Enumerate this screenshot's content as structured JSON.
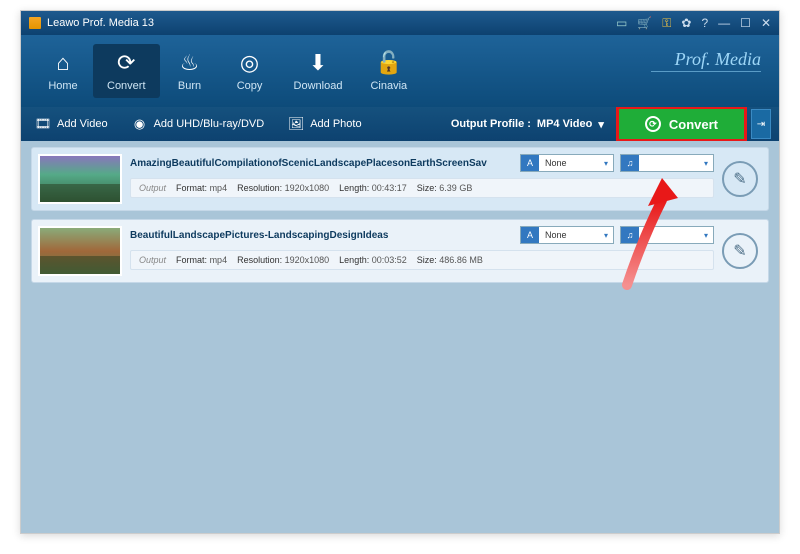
{
  "titlebar": {
    "title": "Leawo Prof. Media 13"
  },
  "toolbar": {
    "home": "Home",
    "convert": "Convert",
    "burn": "Burn",
    "copy": "Copy",
    "download": "Download",
    "cinavia": "Cinavia",
    "brand": "Prof. Media"
  },
  "subbar": {
    "add_video": "Add Video",
    "add_disc": "Add UHD/Blu-ray/DVD",
    "add_photo": "Add Photo",
    "output_profile_label": "Output Profile :",
    "output_profile_value": "MP4 Video",
    "convert": "Convert"
  },
  "items": [
    {
      "title": "AmazingBeautifulCompilationofScenicLandscapePlacesonEarthScreenSav",
      "subtitle_value": "None",
      "output_label": "Output",
      "format_label": "Format:",
      "format_value": "mp4",
      "resolution_label": "Resolution:",
      "resolution_value": "1920x1080",
      "length_label": "Length:",
      "length_value": "00:43:17",
      "size_label": "Size:",
      "size_value": "6.39 GB"
    },
    {
      "title": "BeautifulLandscapePictures-LandscapingDesignIdeas",
      "subtitle_value": "None",
      "output_label": "Output",
      "format_label": "Format:",
      "format_value": "mp4",
      "resolution_label": "Resolution:",
      "resolution_value": "1920x1080",
      "length_label": "Length:",
      "length_value": "00:03:52",
      "size_label": "Size:",
      "size_value": "486.86 MB"
    }
  ]
}
